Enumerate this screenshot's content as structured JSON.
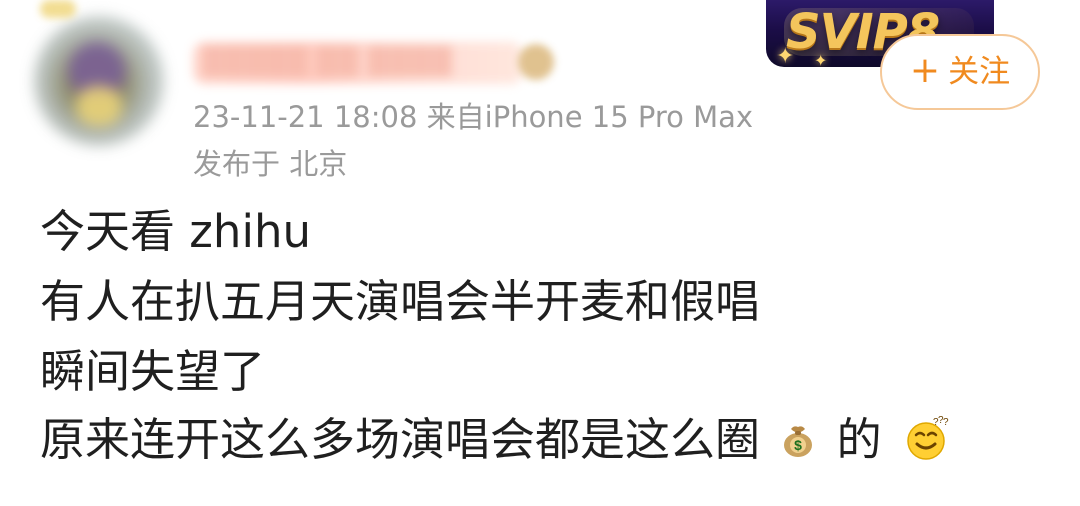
{
  "post": {
    "metadata": {
      "time_source": "23-11-21 18:08  来自iPhone 15 Pro Max",
      "location": "发布于 北京"
    },
    "badges": {
      "svip": "SVIP8"
    },
    "actions": {
      "follow_plus": "+",
      "follow_label": "关注"
    },
    "content": {
      "line1": "今天看 zhihu",
      "line2": "有人在扒五月天演唱会半开麦和假唱",
      "line3": "瞬间失望了",
      "line4_prefix": "原来连开这么多场演唱会都是这么圈",
      "line4_middle": "的"
    },
    "icons": {
      "avatar": "avatar",
      "money_bag": "money-bag-icon",
      "smile": "smile-icon"
    },
    "colors": {
      "meta": "#9a9a9a",
      "text": "#1f1f1f",
      "follow": "#f08a1f",
      "follow_border": "#f5c898"
    }
  }
}
